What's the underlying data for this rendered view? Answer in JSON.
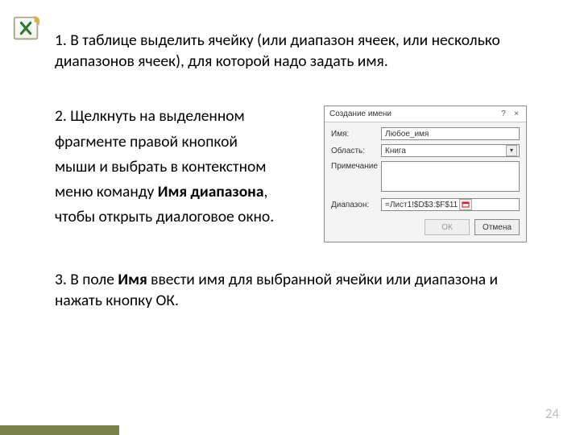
{
  "step1": "1. В таблице выделить ячейку (или диапазон ячеек, или несколько диапазонов ячеек), для которой надо задать имя.",
  "step2": {
    "l1": "2. Щелкнуть на выделенном",
    "l2": "фрагменте правой кнопкой",
    "l3": "мыши и выбрать в контекстном",
    "l4a": "меню команду ",
    "l4b": "Имя диапазона",
    "l4c": ",",
    "l5": "чтобы открыть диалоговое окно."
  },
  "dialog": {
    "title": "Создание имени",
    "help": "?",
    "close": "×",
    "name_label": "Имя:",
    "name_value": "Любое_имя",
    "scope_label": "Область:",
    "scope_value": "Книга",
    "comment_label": "Примечание",
    "range_label": "Диапазон:",
    "range_value": "=Лист1!$D$3:$F$11",
    "ok": "ОК",
    "cancel": "Отмена"
  },
  "step3": {
    "a": "3. В поле ",
    "b": "Имя",
    "c": " ввести имя для выбранной ячейки или диапазона и нажать кнопку ОК."
  },
  "page": "24"
}
